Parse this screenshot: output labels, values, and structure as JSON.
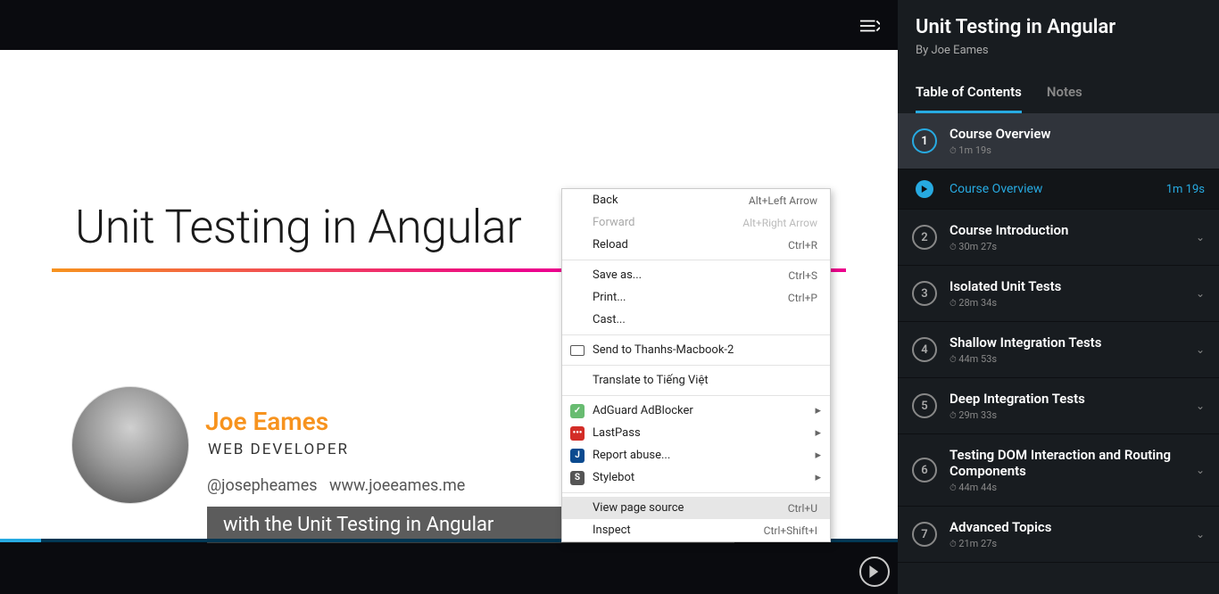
{
  "slide": {
    "title": "Unit Testing in Angular",
    "author_name": "Joe Eames",
    "author_role": "WEB DEVELOPER",
    "handle": "@josepheames",
    "website": "www.joeeames.me",
    "caption": "with the Unit Testing in Angular"
  },
  "sidebar": {
    "course_title": "Unit Testing in Angular",
    "byline": "By Joe Eames",
    "tabs": {
      "toc": "Table of Contents",
      "notes": "Notes"
    },
    "modules": [
      {
        "num": "1",
        "title": "Course Overview",
        "duration": "1m 19s",
        "active": true,
        "clips": [
          {
            "title": "Course Overview",
            "duration": "1m 19s"
          }
        ]
      },
      {
        "num": "2",
        "title": "Course Introduction",
        "duration": "30m 27s"
      },
      {
        "num": "3",
        "title": "Isolated Unit Tests",
        "duration": "28m 34s"
      },
      {
        "num": "4",
        "title": "Shallow Integration Tests",
        "duration": "44m 53s"
      },
      {
        "num": "5",
        "title": "Deep Integration Tests",
        "duration": "29m 33s"
      },
      {
        "num": "6",
        "title": "Testing DOM Interaction and Routing Components",
        "duration": "44m 44s"
      },
      {
        "num": "7",
        "title": "Advanced Topics",
        "duration": "21m 27s"
      }
    ]
  },
  "context_menu": {
    "back": "Back",
    "back_accel": "Alt+Left Arrow",
    "forward": "Forward",
    "forward_accel": "Alt+Right Arrow",
    "reload": "Reload",
    "reload_accel": "Ctrl+R",
    "saveas": "Save as...",
    "saveas_accel": "Ctrl+S",
    "print": "Print...",
    "print_accel": "Ctrl+P",
    "cast": "Cast...",
    "sendto": "Send to Thanhs-Macbook-2",
    "translate": "Translate to Tiếng Việt",
    "adguard": "AdGuard AdBlocker",
    "lastpass": "LastPass",
    "report": "Report abuse...",
    "stylebot": "Stylebot",
    "viewsource": "View page source",
    "viewsource_accel": "Ctrl+U",
    "inspect": "Inspect",
    "inspect_accel": "Ctrl+Shift+I"
  }
}
